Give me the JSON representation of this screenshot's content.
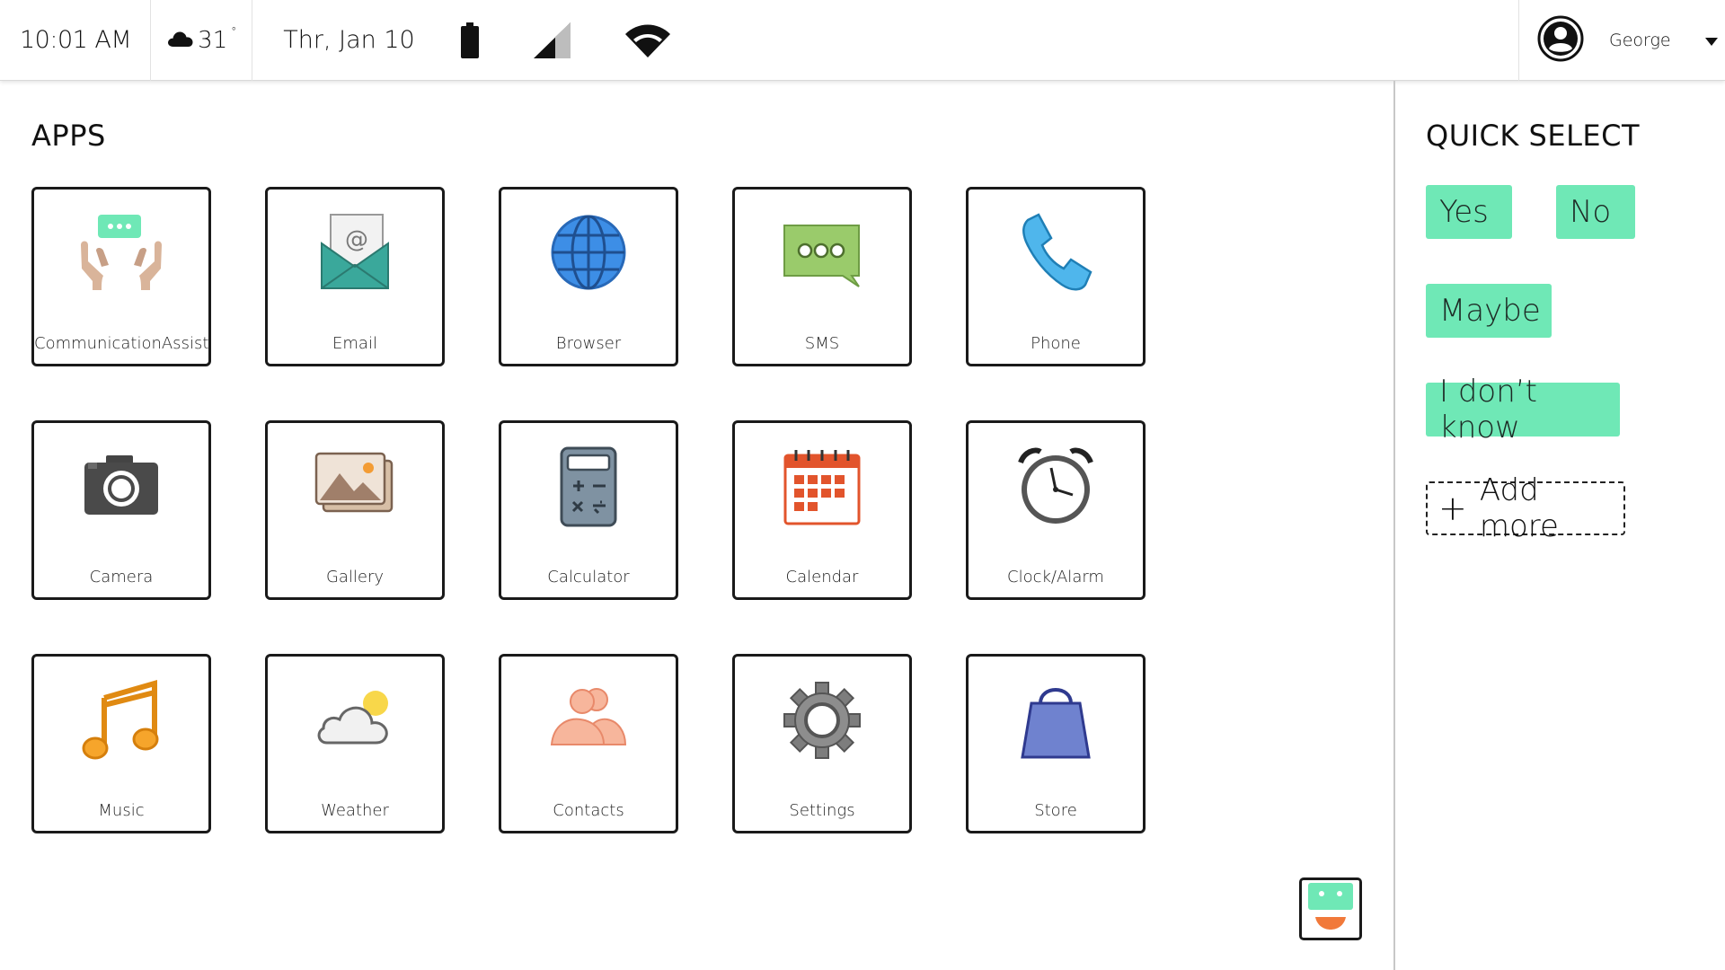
{
  "status_bar": {
    "time": "10:01 AM",
    "temperature": "31",
    "degree_symbol": "°",
    "date": "Thr, Jan 10",
    "weather_icon": "cloud-icon",
    "battery_icon": "battery-icon",
    "signal_icon": "signal-icon",
    "wifi_icon": "wifi-icon",
    "user_name": "George"
  },
  "apps": {
    "title": "APPS",
    "items": [
      {
        "label": "CommunicationAssist",
        "icon": "hands-chat-icon"
      },
      {
        "label": "Email",
        "icon": "email-icon"
      },
      {
        "label": "Browser",
        "icon": "globe-icon"
      },
      {
        "label": "SMS",
        "icon": "sms-bubble-icon"
      },
      {
        "label": "Phone",
        "icon": "phone-icon"
      },
      {
        "label": "Camera",
        "icon": "camera-icon"
      },
      {
        "label": "Gallery",
        "icon": "gallery-icon"
      },
      {
        "label": "Calculator",
        "icon": "calculator-icon"
      },
      {
        "label": "Calendar",
        "icon": "calendar-icon"
      },
      {
        "label": "Clock/Alarm",
        "icon": "alarm-clock-icon"
      },
      {
        "label": "Music",
        "icon": "music-note-icon"
      },
      {
        "label": "Weather",
        "icon": "weather-icon"
      },
      {
        "label": "Contacts",
        "icon": "contacts-icon"
      },
      {
        "label": "Settings",
        "icon": "gear-icon"
      },
      {
        "label": "Store",
        "icon": "shopping-bag-icon"
      }
    ]
  },
  "quick_select": {
    "title": "QUICK SELECT",
    "options": [
      "Yes",
      "No",
      "Maybe",
      "I don’t know"
    ],
    "add_more_label": "Add more"
  },
  "colors": {
    "chip": "#6fe8b6",
    "tile_border": "#1a1a1a",
    "divider": "#c8c8c8"
  }
}
